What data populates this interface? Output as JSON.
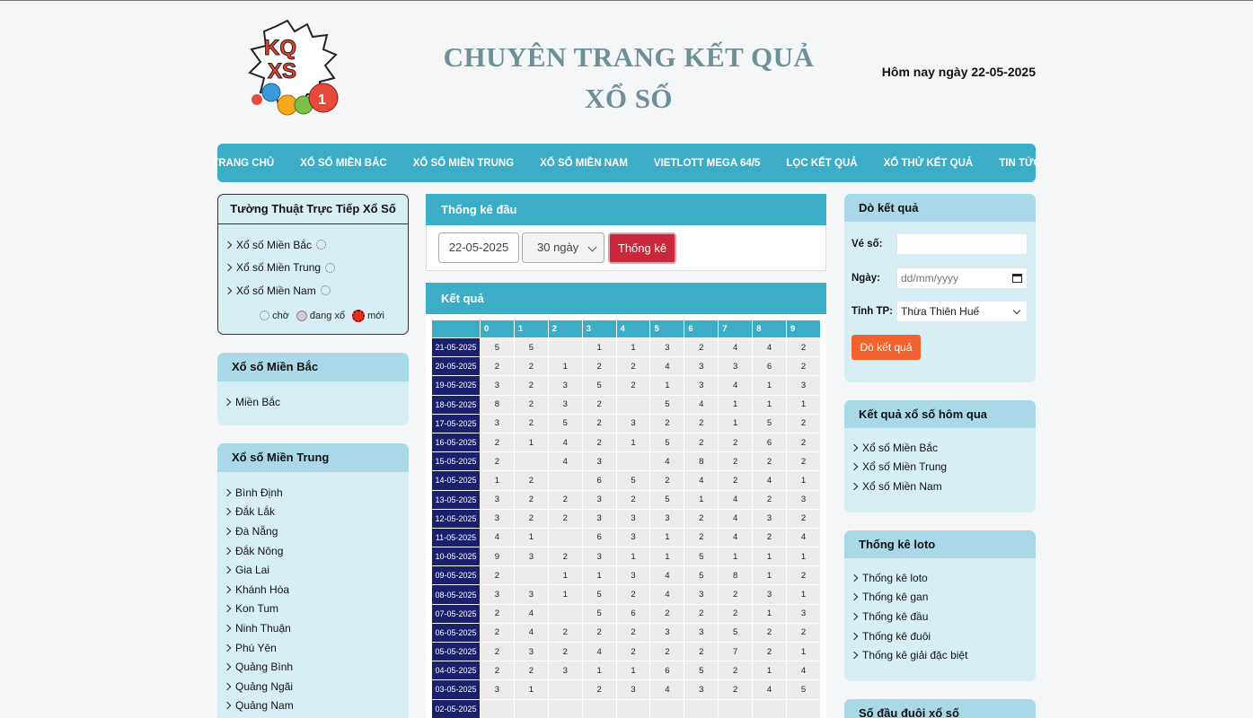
{
  "header": {
    "logo_text": "KQXS",
    "title_line1": "CHUYÊN TRANG KẾT QUẢ",
    "title_line2": "XỔ SỐ",
    "today": "Hôm nay ngày 22-05-2025"
  },
  "nav": [
    "TRANG CHỦ",
    "XỔ SỐ MIỀN BẮC",
    "XỔ SỐ MIỀN TRUNG",
    "XỔ SỐ MIỀN NAM",
    "VIETLOTT MEGA 64/5",
    "LỌC KẾT QUẢ",
    "XỔ THỬ KẾT QUẢ",
    "TIN TỨC"
  ],
  "live": {
    "title": "Tường Thuật Trực Tiếp Xổ Số",
    "items": [
      "Xổ số Miền Bắc",
      "Xổ số Miền Trung",
      "Xổ số Miền Nam"
    ],
    "legend": {
      "wait": "chờ",
      "drawing": "đang xổ",
      "new": "mới"
    }
  },
  "mien_bac": {
    "title": "Xổ số Miền Bắc",
    "items": [
      "Miền Bắc"
    ]
  },
  "mien_trung": {
    "title": "Xổ số Miền Trung",
    "items": [
      "Bình Định",
      "Đắk Lắk",
      "Đà Nẵng",
      "Đắk Nông",
      "Gia Lai",
      "Khánh Hòa",
      "Kon Tum",
      "Ninh Thuận",
      "Phú Yên",
      "Quảng Bình",
      "Quảng Ngãi",
      "Quảng Nam"
    ]
  },
  "filter": {
    "title": "Thống kê đầu",
    "date": "22-05-2025",
    "days": "30 ngày",
    "button": "Thống kê"
  },
  "results": {
    "title": "Kết quả",
    "columns": [
      "0",
      "1",
      "2",
      "3",
      "4",
      "5",
      "6",
      "7",
      "8",
      "9"
    ],
    "rows": [
      {
        "date": "21-05-2025",
        "v": [
          "5",
          "5",
          "",
          "1",
          "1",
          "3",
          "2",
          "4",
          "4",
          "2"
        ]
      },
      {
        "date": "20-05-2025",
        "v": [
          "2",
          "2",
          "1",
          "2",
          "2",
          "4",
          "3",
          "3",
          "6",
          "2"
        ]
      },
      {
        "date": "19-05-2025",
        "v": [
          "3",
          "2",
          "3",
          "5",
          "2",
          "1",
          "3",
          "4",
          "1",
          "3"
        ]
      },
      {
        "date": "18-05-2025",
        "v": [
          "8",
          "2",
          "3",
          "2",
          "",
          "5",
          "4",
          "1",
          "1",
          "1"
        ]
      },
      {
        "date": "17-05-2025",
        "v": [
          "3",
          "2",
          "5",
          "2",
          "3",
          "2",
          "2",
          "1",
          "5",
          "2"
        ]
      },
      {
        "date": "16-05-2025",
        "v": [
          "2",
          "1",
          "4",
          "2",
          "1",
          "5",
          "2",
          "2",
          "6",
          "2"
        ]
      },
      {
        "date": "15-05-2025",
        "v": [
          "2",
          "",
          "4",
          "3",
          "",
          "4",
          "8",
          "2",
          "2",
          "2"
        ]
      },
      {
        "date": "14-05-2025",
        "v": [
          "1",
          "2",
          "",
          "6",
          "5",
          "2",
          "4",
          "2",
          "4",
          "1"
        ]
      },
      {
        "date": "13-05-2025",
        "v": [
          "3",
          "2",
          "2",
          "3",
          "2",
          "5",
          "1",
          "4",
          "2",
          "3"
        ]
      },
      {
        "date": "12-05-2025",
        "v": [
          "3",
          "2",
          "2",
          "3",
          "3",
          "3",
          "2",
          "4",
          "3",
          "2"
        ]
      },
      {
        "date": "11-05-2025",
        "v": [
          "4",
          "1",
          "",
          "6",
          "3",
          "1",
          "2",
          "4",
          "2",
          "4"
        ]
      },
      {
        "date": "10-05-2025",
        "v": [
          "9",
          "3",
          "2",
          "3",
          "1",
          "1",
          "5",
          "1",
          "1",
          "1"
        ]
      },
      {
        "date": "09-05-2025",
        "v": [
          "2",
          "",
          "1",
          "1",
          "3",
          "4",
          "5",
          "8",
          "1",
          "2"
        ]
      },
      {
        "date": "08-05-2025",
        "v": [
          "3",
          "3",
          "1",
          "5",
          "2",
          "4",
          "3",
          "2",
          "3",
          "1"
        ]
      },
      {
        "date": "07-05-2025",
        "v": [
          "2",
          "4",
          "",
          "5",
          "6",
          "2",
          "2",
          "2",
          "1",
          "3"
        ]
      },
      {
        "date": "06-05-2025",
        "v": [
          "2",
          "4",
          "2",
          "2",
          "2",
          "3",
          "3",
          "5",
          "2",
          "2"
        ]
      },
      {
        "date": "05-05-2025",
        "v": [
          "2",
          "3",
          "2",
          "4",
          "2",
          "2",
          "2",
          "7",
          "2",
          "1"
        ]
      },
      {
        "date": "04-05-2025",
        "v": [
          "2",
          "2",
          "3",
          "1",
          "1",
          "6",
          "5",
          "2",
          "1",
          "4"
        ]
      },
      {
        "date": "03-05-2025",
        "v": [
          "3",
          "1",
          "",
          "2",
          "3",
          "4",
          "3",
          "2",
          "4",
          "5"
        ]
      },
      {
        "date": "02-05-2025",
        "v": [
          "",
          "",
          "",
          "",
          "",
          "",
          "",
          "",
          "",
          ""
        ]
      }
    ]
  },
  "do_ket_qua": {
    "title": "Dò kết quả",
    "ve_so_label": "Vé số:",
    "ngay_label": "Ngày:",
    "ngay_placeholder": "dd/mm/yyyy",
    "tinh_label": "Tỉnh TP:",
    "tinh_value": "Thừa Thiên Huế",
    "button": "Dò kết quả"
  },
  "hom_qua": {
    "title": "Kết quả xổ số hôm qua",
    "items": [
      "Xổ số Miền Bắc",
      "Xổ số Miền Trung",
      "Xổ số Miền Nam"
    ]
  },
  "thong_ke_loto": {
    "title": "Thống kê loto",
    "items": [
      "Thống kê loto",
      "Thống kê gan",
      "Thống kê đầu",
      "Thống kê đuôi",
      "Thống kê giải đặc biệt"
    ]
  },
  "so_dau_duoi": {
    "title": "Số đầu đuôi xổ số"
  },
  "colors": {
    "accent": "#3cadc6",
    "header_light": "#a9d9e6",
    "panel_bg": "#d8eef5",
    "date_cell": "#1a1f6e",
    "stat_button": "#c8283a",
    "do_button": "#f2622e"
  }
}
